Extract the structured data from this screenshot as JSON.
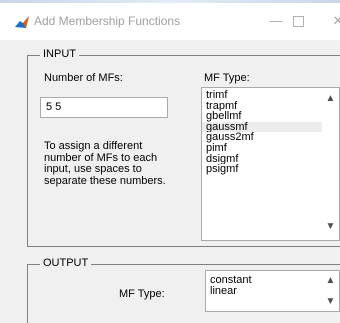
{
  "window": {
    "title": "Add Membership Functions",
    "minimize_label": "—",
    "close_label": "✕",
    "icon_color": "#1a6fc9",
    "icon_accent": "#e36209"
  },
  "input_group": {
    "legend": "INPUT",
    "num_mfs_label": "Number of MFs:",
    "num_mfs_value": "5 5",
    "help_text": "To assign a different number of MFs to each input, use spaces to separate these numbers.",
    "mf_type_label": "MF Type:",
    "mf_types": [
      "trimf",
      "trapmf",
      "gbellmf",
      "gaussmf",
      "gauss2mf",
      "pimf",
      "dsigmf",
      "psigmf"
    ],
    "selected_mf_type": "gaussmf"
  },
  "output_group": {
    "legend": "OUTPUT",
    "mf_type_label": "MF Type:",
    "mf_types": [
      "constant",
      "linear"
    ],
    "selected_mf_type": "linear"
  },
  "icons": {
    "scroll_up": "▲",
    "scroll_down": "▼"
  }
}
